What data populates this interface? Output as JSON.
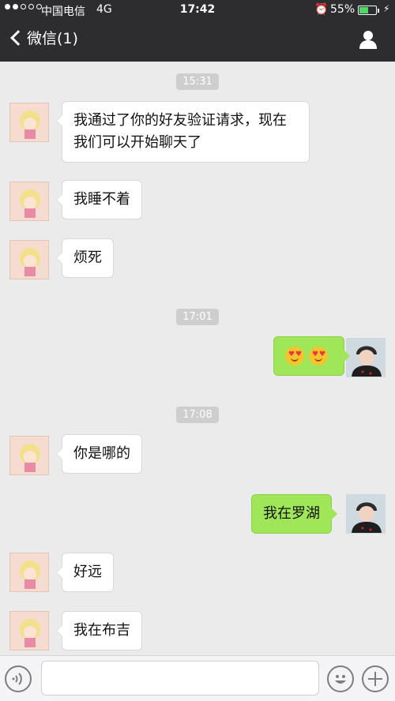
{
  "status_bar": {
    "carrier": "中国电信",
    "network": "4G",
    "time": "17:42",
    "battery_text": "55%",
    "battery_level": 0.55
  },
  "nav": {
    "back_label": "微信(1)"
  },
  "chat": {
    "timestamps": [
      "15:31",
      "17:01",
      "17:08"
    ],
    "messages": [
      {
        "from": "them",
        "text": "我通过了你的好友验证请求，现在我们可以开始聊天了"
      },
      {
        "from": "them",
        "text": "我睡不着"
      },
      {
        "from": "them",
        "text": "烦死"
      },
      {
        "from": "me",
        "emoji": [
          "heart-eyes-emoji",
          "heart-eyes-emoji"
        ]
      },
      {
        "from": "them",
        "text": "你是哪的"
      },
      {
        "from": "me",
        "text": "我在罗湖"
      },
      {
        "from": "them",
        "text": "好远"
      },
      {
        "from": "them",
        "text": "我在布吉"
      }
    ]
  },
  "colors": {
    "header_bg": "#2d2d2f",
    "chat_bg": "#ebebeb",
    "outgoing_bubble": "#9fe658",
    "incoming_bubble": "#ffffff"
  },
  "icons": [
    "chevron-left-icon",
    "person-icon",
    "voice-icon",
    "emoji-icon",
    "plus-icon"
  ]
}
